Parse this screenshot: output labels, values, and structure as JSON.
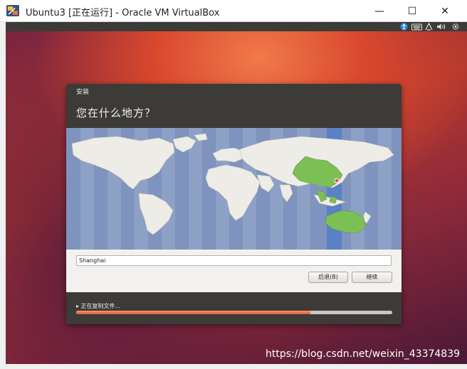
{
  "window": {
    "title": "Ubuntu3 [正在运行] - Oracle VM VirtualBox",
    "minimize_glyph": "—",
    "maximize_glyph": "☐",
    "close_glyph": "✕"
  },
  "indicators": [
    "accessibility-icon",
    "keyboard-icon",
    "network-icon",
    "volume-icon",
    "gear-icon"
  ],
  "dialog": {
    "title": "安装",
    "question": "您在什么地方？",
    "timezone_value": "Shanghai",
    "back_label": "后退(B)",
    "continue_label": "继续",
    "status_text": "▸ 正在复制文件...",
    "progress": 0.74
  },
  "watermark": "https://blog.csdn.net/weixin_43374839",
  "colors": {
    "accent": "#e0572e",
    "selected_region": "#7cc055",
    "map_ocean": "#7e93bd",
    "timezone_band": "#5a80c6"
  }
}
